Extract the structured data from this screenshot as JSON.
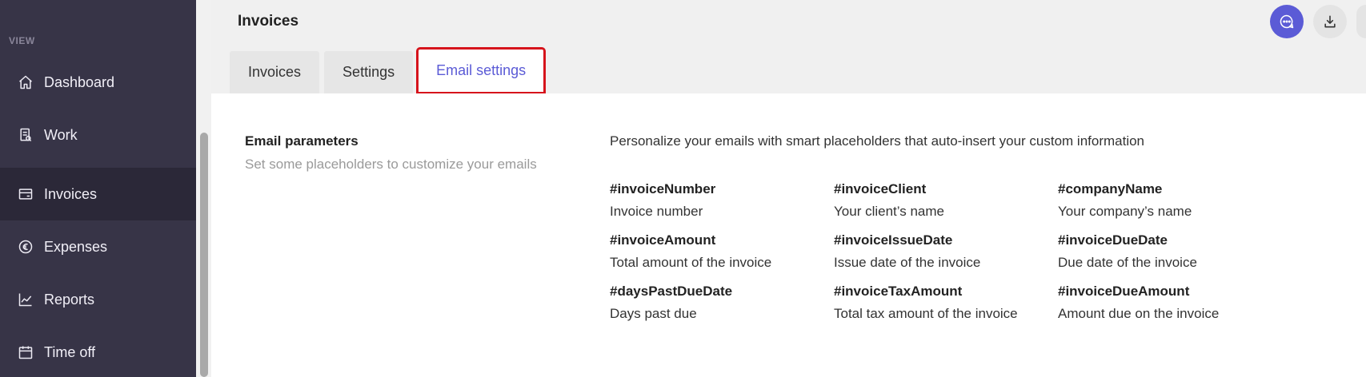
{
  "sidebar": {
    "heading": "VIEW",
    "items": [
      {
        "label": "Dashboard",
        "icon": "home-icon"
      },
      {
        "label": "Work",
        "icon": "document-icon"
      },
      {
        "label": "Invoices",
        "icon": "invoice-icon",
        "active": true
      },
      {
        "label": "Expenses",
        "icon": "euro-icon"
      },
      {
        "label": "Reports",
        "icon": "chart-icon"
      },
      {
        "label": "Time off",
        "icon": "calendar-icon"
      }
    ]
  },
  "header": {
    "title": "Invoices",
    "tabs": [
      {
        "label": "Invoices"
      },
      {
        "label": "Settings"
      },
      {
        "label": "Email settings",
        "active": true
      }
    ],
    "actions": [
      {
        "icon": "chat-icon"
      },
      {
        "icon": "download-icon"
      }
    ]
  },
  "content": {
    "section_title": "Email parameters",
    "section_subtitle": "Set some placeholders to customize your emails",
    "intro": "Personalize your emails with smart placeholders that auto-insert your custom information",
    "placeholders": [
      {
        "name": "#invoiceNumber",
        "desc": "Invoice number"
      },
      {
        "name": "#invoiceClient",
        "desc": "Your client’s name"
      },
      {
        "name": "#companyName",
        "desc": "Your company’s name"
      },
      {
        "name": "#invoiceAmount",
        "desc": "Total amount of the invoice"
      },
      {
        "name": "#invoiceIssueDate",
        "desc": "Issue date of the invoice"
      },
      {
        "name": "#invoiceDueDate",
        "desc": "Due date of the invoice"
      },
      {
        "name": "#daysPastDueDate",
        "desc": "Days past due"
      },
      {
        "name": "#invoiceTaxAmount",
        "desc": "Total tax amount of the invoice"
      },
      {
        "name": "#invoiceDueAmount",
        "desc": "Amount due on the invoice"
      }
    ]
  },
  "colors": {
    "sidebar_bg": "#373447",
    "sidebar_active_bg": "#2b2838",
    "accent": "#5b5bd6",
    "highlight_border": "#d6141c"
  }
}
